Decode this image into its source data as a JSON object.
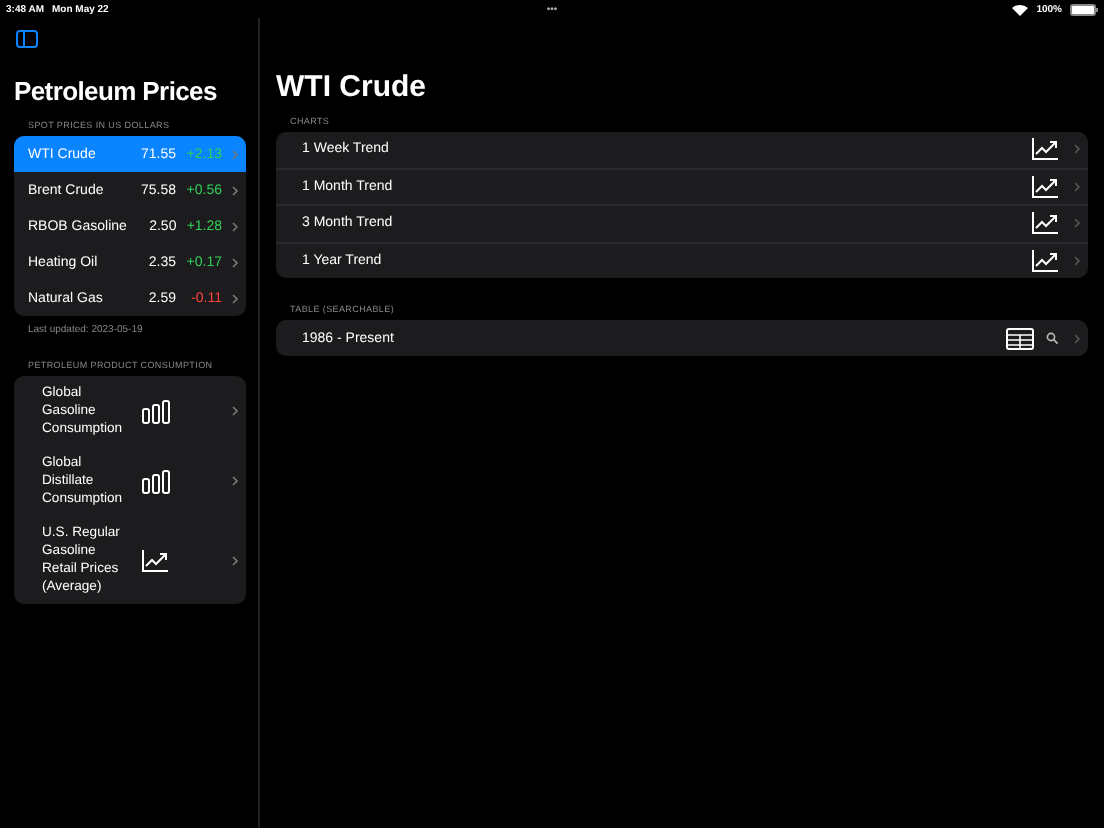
{
  "status_bar": {
    "time": "3:48 AM",
    "date": "Mon May 22",
    "more": "•••",
    "battery": "100%"
  },
  "sidebar": {
    "title": "Petroleum Prices",
    "spot_section": {
      "header": "SPOT PRICES IN US DOLLARS",
      "items": [
        {
          "name": "WTI Crude",
          "price": "71.55",
          "change": "+2.13",
          "color": "#30d158",
          "selected": true
        },
        {
          "name": "Brent Crude",
          "price": "75.58",
          "change": "+0.56",
          "color": "#30d158",
          "selected": false
        },
        {
          "name": "RBOB Gasoline",
          "price": "2.50",
          "change": "+1.28",
          "color": "#30d158",
          "selected": false
        },
        {
          "name": "Heating Oil",
          "price": "2.35",
          "change": "+0.17",
          "color": "#30d158",
          "selected": false
        },
        {
          "name": "Natural Gas",
          "price": "2.59",
          "change": "-0.11",
          "color": "#ff453a",
          "selected": false
        }
      ],
      "footer": "Last updated: 2023-05-19"
    },
    "consumption_section": {
      "header": "PETROLEUM PRODUCT CONSUMPTION",
      "items": [
        {
          "name": "Global Gasoline Consumption",
          "kind": "bars"
        },
        {
          "name": "Global Distillate Consumption",
          "kind": "bars"
        },
        {
          "name": "U.S. Regular Gasoline Retail Prices (Average)",
          "kind": "line"
        }
      ]
    }
  },
  "detail": {
    "title": "WTI Crude",
    "charts": {
      "header": "CHARTS",
      "items": [
        "1 Week Trend",
        "1 Month Trend",
        "3 Month Trend",
        "1 Year Trend"
      ]
    },
    "table": {
      "header": "TABLE (SEARCHABLE)",
      "items": [
        "1986 - Present"
      ]
    }
  }
}
